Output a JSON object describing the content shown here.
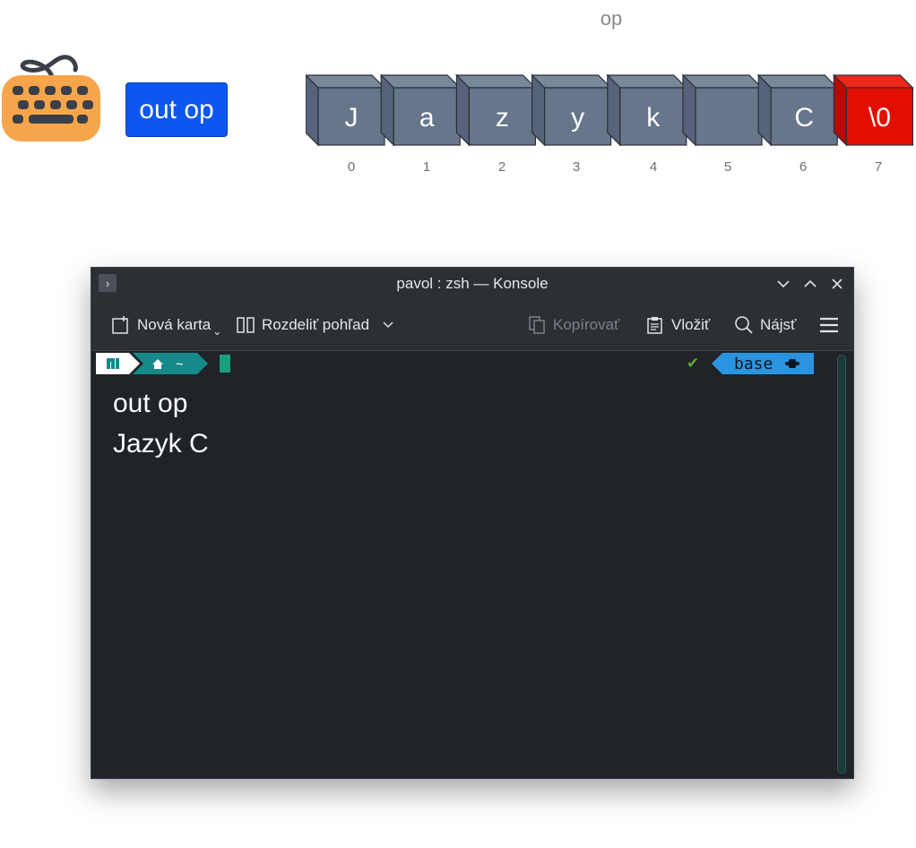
{
  "diagram": {
    "op_label": "op",
    "out_button": "out op",
    "cells": [
      "J",
      "a",
      "z",
      "y",
      "k",
      "",
      "C",
      "\\0"
    ],
    "indices": [
      "0",
      "1",
      "2",
      "3",
      "4",
      "5",
      "6",
      "7"
    ],
    "colors": {
      "cell": "#67768a",
      "terminator": "#e30e00",
      "button": "#0b57f0"
    }
  },
  "window": {
    "title": "pavol : zsh — Konsole",
    "toolbar": {
      "new_tab": "Nová karta",
      "split_view": "Rozdeliť pohľad",
      "copy": "Kopírovať",
      "paste": "Vložiť",
      "find": "Nájsť"
    },
    "prompt": {
      "home_symbol": "~",
      "env": "base"
    },
    "output": [
      "out op",
      "Jazyk C"
    ]
  },
  "icons": [
    "keyboard-icon",
    "terminal-icon",
    "chevron-down-icon",
    "chevron-up-icon",
    "close-icon",
    "new-tab-icon",
    "split-view-icon",
    "copy-icon",
    "paste-icon",
    "search-icon",
    "hamburger-menu-icon",
    "manjaro-icon",
    "home-icon",
    "python-icon"
  ]
}
